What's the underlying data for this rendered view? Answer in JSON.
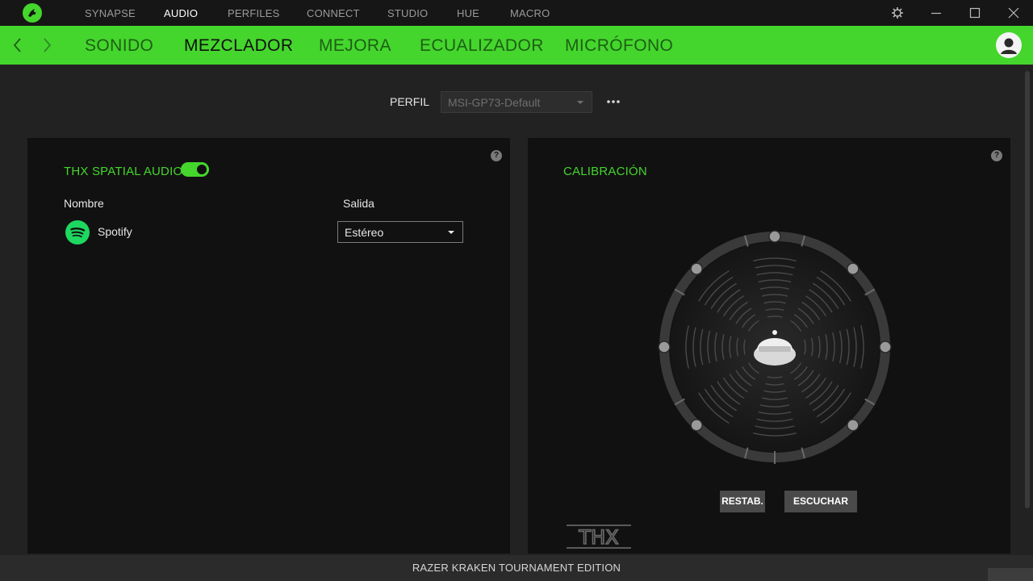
{
  "top_nav": [
    "SYNAPSE",
    "AUDIO",
    "PERFILES",
    "CONNECT",
    "STUDIO",
    "HUE",
    "MACRO"
  ],
  "top_nav_active": "AUDIO",
  "sub_nav": [
    "SONIDO",
    "MEZCLADOR",
    "MEJORA",
    "ECUALIZADOR",
    "MICRÓFONO"
  ],
  "sub_nav_active": "MEZCLADOR",
  "profile": {
    "label": "PERFIL",
    "value": "MSI-GP73-Default"
  },
  "mixer": {
    "title": "THX SPATIAL AUDIO",
    "toggle_on": true,
    "col_name": "Nombre",
    "col_output": "Salida",
    "app_name": "Spotify",
    "app_output": "Estéreo"
  },
  "calibration": {
    "title": "CALIBRACIÓN",
    "reset_label": "RESTAB.",
    "listen_label": "ESCUCHAR",
    "logo_text": "THX"
  },
  "help_label": "?",
  "footer": {
    "device": "RAZER KRAKEN TOURNAMENT EDITION"
  },
  "colors": {
    "accent": "#44d62c",
    "panel": "#111111",
    "background": "#222222",
    "topbar": "#161616"
  },
  "icons": [
    "razer-logo-icon",
    "settings-icon",
    "minimize-icon",
    "maximize-icon",
    "close-icon",
    "back-arrow-icon",
    "forward-arrow-icon",
    "user-avatar-icon",
    "more-options-icon",
    "help-icon",
    "spotify-icon",
    "headset-icon"
  ]
}
